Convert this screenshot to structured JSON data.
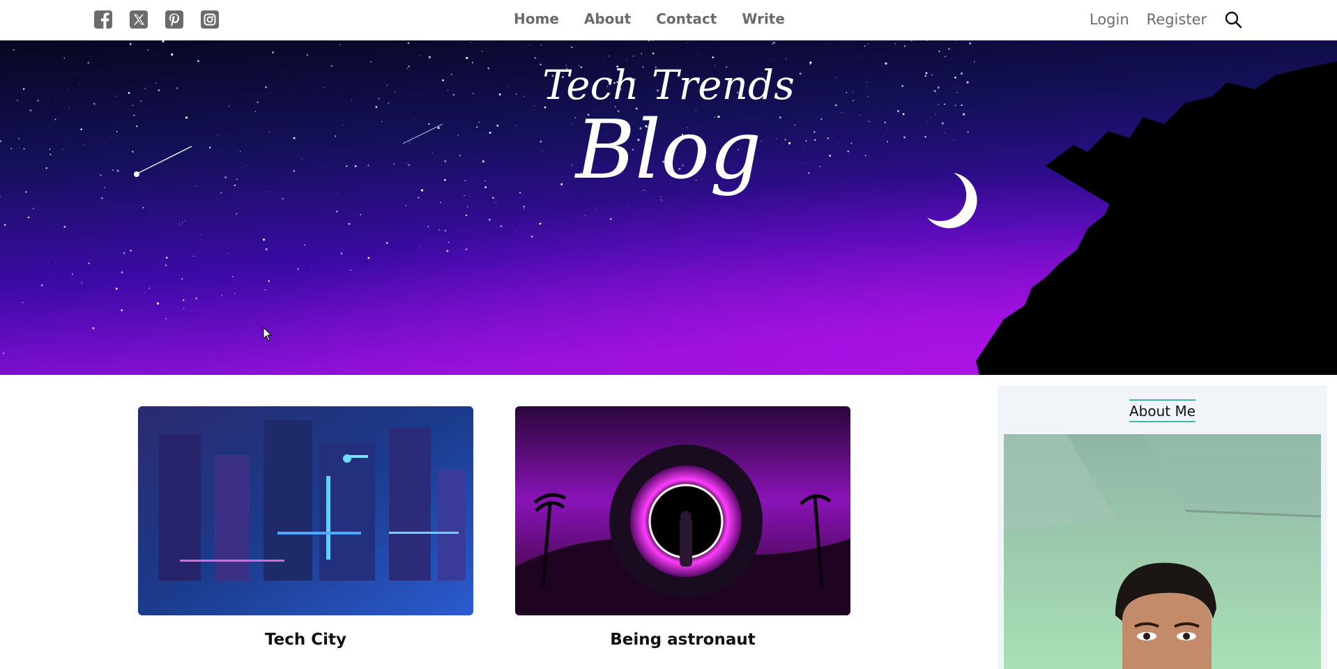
{
  "social": [
    {
      "name": "facebook",
      "icon": "facebook-icon"
    },
    {
      "name": "x",
      "icon": "x-twitter-icon"
    },
    {
      "name": "pinterest",
      "icon": "pinterest-icon"
    },
    {
      "name": "instagram",
      "icon": "instagram-icon"
    }
  ],
  "nav": {
    "home": "Home",
    "about": "About",
    "contact": "Contact",
    "write": "Write"
  },
  "auth": {
    "login": "Login",
    "register": "Register",
    "search_icon": "search-icon"
  },
  "hero": {
    "subtitle": "Tech Trends",
    "title": "Blog"
  },
  "posts": [
    {
      "title": "Tech City"
    },
    {
      "title": "Being astronaut"
    }
  ],
  "sidebar": {
    "title": "About Me"
  },
  "colors": {
    "nav_text": "#6b6b6b",
    "accent": "#3db8a7",
    "sidebar_bg": "#f1f4f8",
    "hero_top": "#0a0a2a",
    "hero_bottom": "#8a0fd8"
  }
}
